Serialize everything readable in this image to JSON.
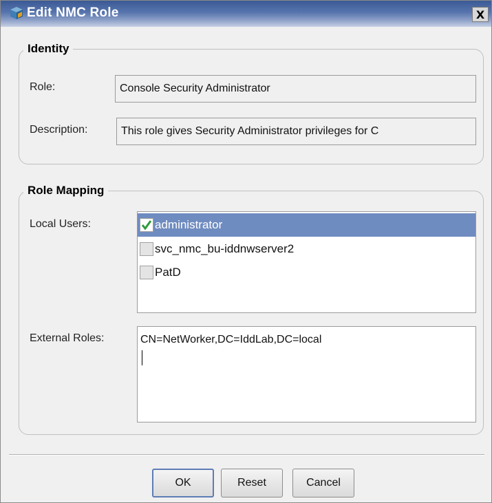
{
  "window": {
    "title": "Edit NMC Role",
    "close_label": "X"
  },
  "identity": {
    "legend": "Identity",
    "role_label": "Role:",
    "role_value": "Console Security Administrator",
    "description_label": "Description:",
    "description_value": "This role gives Security Administrator privileges for C"
  },
  "mapping": {
    "legend": "Role Mapping",
    "local_users_label": "Local Users:",
    "local_users": [
      {
        "name": "administrator",
        "checked": true,
        "selected": true
      },
      {
        "name": "svc_nmc_bu-iddnwserver2",
        "checked": false,
        "selected": false
      },
      {
        "name": "PatD",
        "checked": false,
        "selected": false
      }
    ],
    "external_roles_label": "External Roles:",
    "external_roles_value": "CN=NetWorker,DC=IddLab,DC=local"
  },
  "buttons": {
    "ok": "OK",
    "reset": "Reset",
    "cancel": "Cancel"
  },
  "colors": {
    "title_bar": "#4a69a5",
    "selection": "#6f8cc0",
    "check": "#2e9a3a"
  }
}
